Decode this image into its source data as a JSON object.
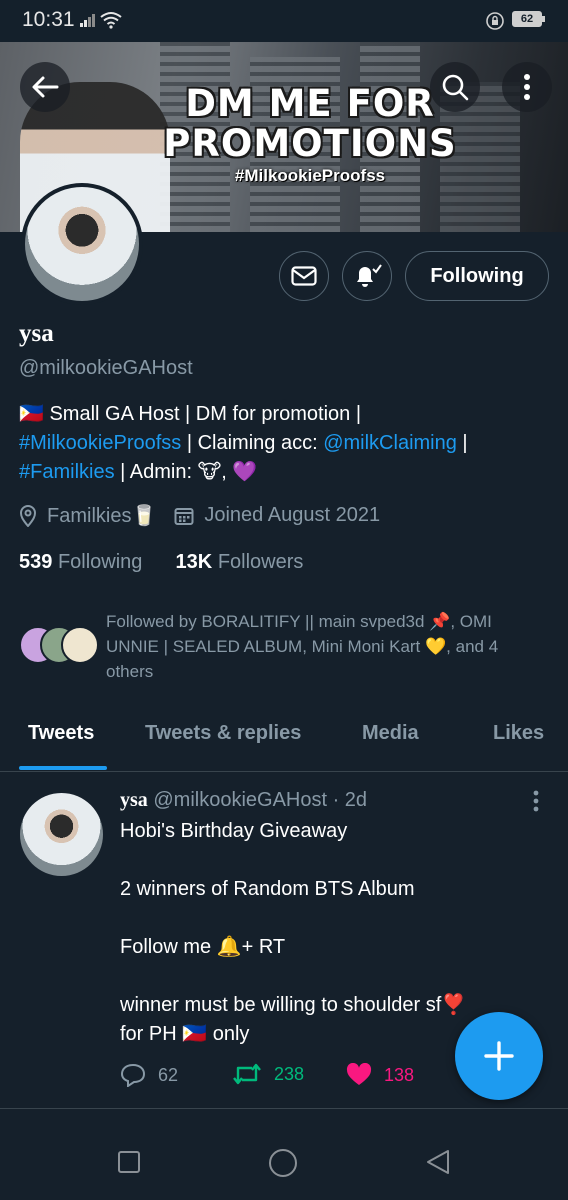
{
  "status_bar": {
    "time": "10:31",
    "battery": "62"
  },
  "banner": {
    "headline": "DM ME FOR PROMOTIONS",
    "hashtag": "#MilkookieProofss"
  },
  "profile": {
    "name": "ysa",
    "handle": "@milkookieGAHost",
    "follow_label": "Following",
    "bio": {
      "flag": "🇵🇭",
      "line1": " Small GA Host | DM for promotion |",
      "tag1": "#MilkookieProofss",
      "mid": " | Claiming acc: ",
      "mention": "@milkClaiming",
      "pipe": " |",
      "tag2": "#Familkies",
      "admin": " | Admin: 🐮, 💜"
    },
    "location": "Familkies🥛",
    "joined": "Joined August 2021",
    "following_count": "539",
    "following_label": "Following",
    "followers_count": "13K",
    "followers_label": "Followers",
    "followed_by": "Followed by BORALITIFY || main svped3d 📌, OMI UNNIE | SEALED ALBUM, Mini Moni Kart 💛, and 4 others"
  },
  "tabs": [
    {
      "label": "Tweets"
    },
    {
      "label": "Tweets & replies"
    },
    {
      "label": "Media"
    },
    {
      "label": "Likes"
    }
  ],
  "tweet": {
    "name": "ysa",
    "meta": " @milkookieGAHost · 2d",
    "text": "Hobi's Birthday Giveaway\n\n2 winners of Random BTS Album\n\nFollow me 🔔+ RT\n\nwinner must be willing to shoulder sf❣️\nfor PH 🇵🇭 only",
    "replies": "62",
    "retweets": "238",
    "likes": "138"
  },
  "colors": {
    "accent": "#1d9bf0",
    "retweet": "#00ba7c",
    "like": "#f91880",
    "background": "#15202b"
  }
}
